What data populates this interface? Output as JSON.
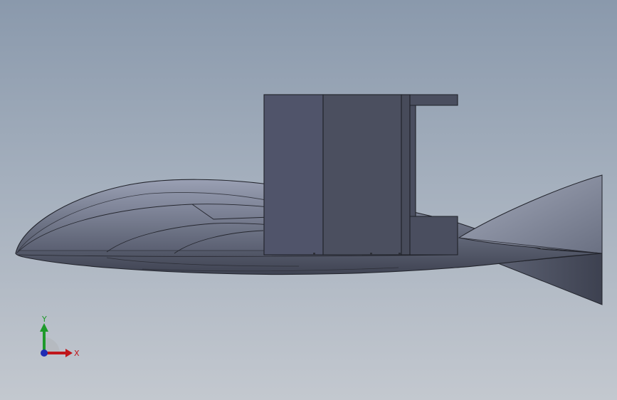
{
  "viewport": {
    "background_top": "#8a99ac",
    "background_bottom": "#c3c8cf"
  },
  "model": {
    "body_color": "#6f7587",
    "body_highlight": "#8a90a2",
    "body_shadow": "#4a4f5e",
    "block_color": "#4c5060",
    "block_dark": "#3c3f4c",
    "edge_color": "#1f2128"
  },
  "triad": {
    "x_label": "X",
    "y_label": "Y",
    "x_color": "#c0161b",
    "y_color": "#1e9a2a",
    "z_color": "#1f2cb4"
  }
}
